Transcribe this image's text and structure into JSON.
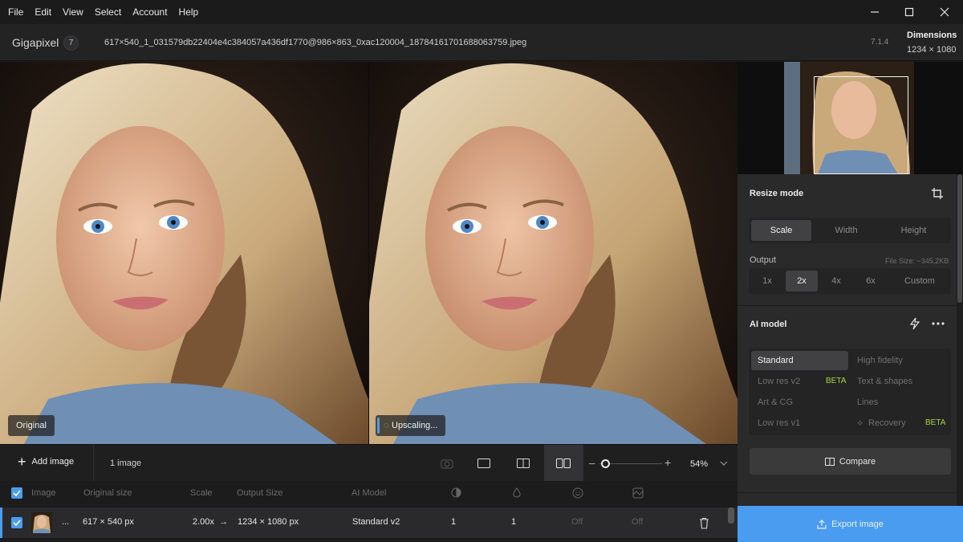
{
  "menu": [
    "File",
    "Edit",
    "View",
    "Select",
    "Account",
    "Help"
  ],
  "header": {
    "app_name": "Gigapixel",
    "badge": "7",
    "file_name": "617×540_1_031579db22404e4c384057a436df1770@986×863_0xac120004_18784161701688063759.jpeg",
    "version": "7.1.4",
    "dimensions_label": "Dimensions",
    "dimensions_value": "1234 × 1080"
  },
  "preview": {
    "left_label": "Original",
    "right_label": "Upscaling..."
  },
  "sidebar": {
    "resize_mode_title": "Resize mode",
    "resize_tabs": [
      "Scale",
      "Width",
      "Height"
    ],
    "output_label": "Output",
    "file_size": "File Size: ~345,2KB",
    "scales": [
      "1x",
      "2x",
      "4x",
      "6x",
      "Custom"
    ],
    "ai_model_title": "AI model",
    "models": [
      {
        "label": "Standard",
        "beta": ""
      },
      {
        "label": "High fidelity",
        "beta": ""
      },
      {
        "label": "Low res v2",
        "beta": "BETA"
      },
      {
        "label": "Text & shapes",
        "beta": ""
      },
      {
        "label": "Art & CG",
        "beta": ""
      },
      {
        "label": "Lines",
        "beta": ""
      },
      {
        "label": "Low res v1",
        "beta": ""
      },
      {
        "label": "Recovery",
        "beta": "BETA"
      }
    ],
    "compare_label": "Compare",
    "export_label": "Export image"
  },
  "toolbar": {
    "add_image": "Add image",
    "image_count": "1 image",
    "zoom": "54%"
  },
  "table": {
    "headers": [
      "Image",
      "Original size",
      "Scale",
      "Output Size",
      "AI Model"
    ],
    "row": {
      "ellipsis": "...",
      "original_size": "617 × 540 px",
      "scale": "2.00x",
      "output_size": "1234 × 1080 px",
      "model": "Standard v2",
      "col1": "1",
      "col2": "1",
      "col3": "Off",
      "col4": "Off"
    }
  },
  "colors": {
    "accent": "#4a9cf0",
    "beta": "#a6d63c"
  }
}
